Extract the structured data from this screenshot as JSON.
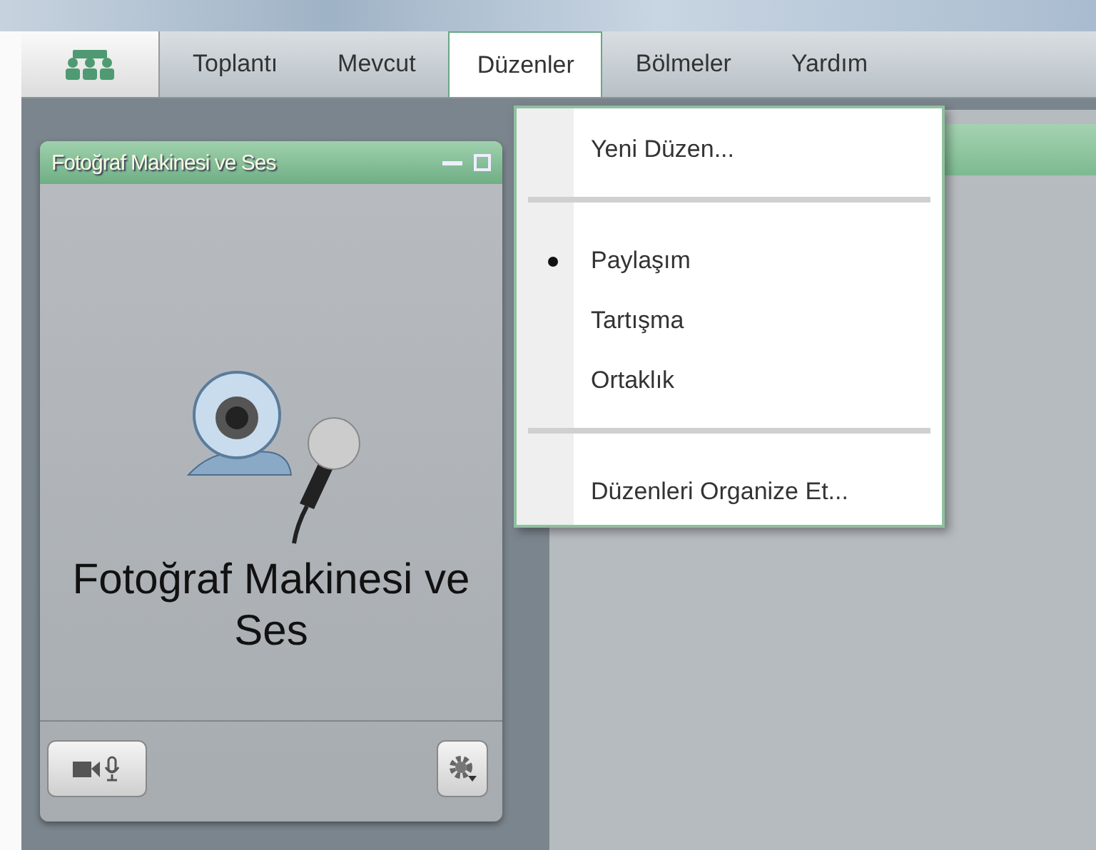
{
  "menu_bar": {
    "items": [
      {
        "label": "Toplantı",
        "selected": false
      },
      {
        "label": "Mevcut",
        "selected": false
      },
      {
        "label": "Düzenler",
        "selected": true
      },
      {
        "label": "Bölmeler",
        "selected": false
      },
      {
        "label": "Yardım",
        "selected": false
      }
    ]
  },
  "pod": {
    "title": "Fotoğraf Makinesi ve Ses",
    "message": "Fotoğraf Makinesi ve Ses"
  },
  "dropdown": {
    "groups": [
      [
        {
          "label": "Yeni Düzen...",
          "checked": false
        }
      ],
      [
        {
          "label": "Paylaşım",
          "checked": true
        },
        {
          "label": "Tartışma",
          "checked": false
        },
        {
          "label": "Ortaklık",
          "checked": false
        }
      ],
      [
        {
          "label": "Düzenleri Organize Et...",
          "checked": false
        }
      ]
    ]
  }
}
